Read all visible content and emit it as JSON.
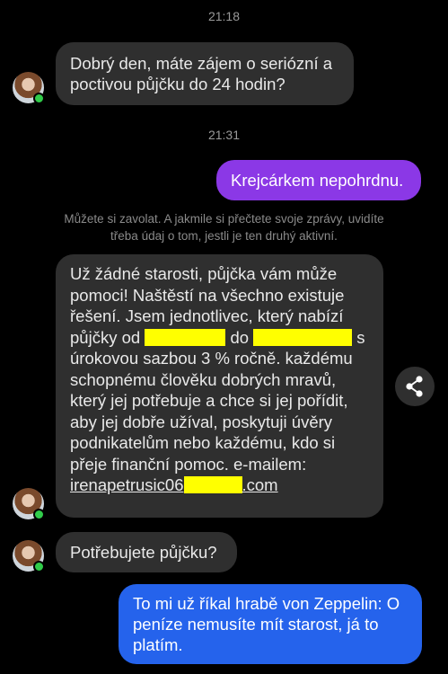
{
  "messages": {
    "ts1": "21:18",
    "msg1": "Dobrý den, máte zájem o seriózní a poctivou půjčku do 24 hodin?",
    "ts2": "21:31",
    "msg2": "Krejcárkem nepohrdnu.",
    "notice": "Můžete si zavolat. A jakmile si přečtete svoje zprávy, uvidíte třeba údaj o tom, jestli je ten druhý aktivní.",
    "msg3_part1": "Už žádné starosti, půjčka vám může pomoci!  Naštěstí na všechno existuje řešení.  Jsem jednotlivec, který nabízí půjčky od",
    "msg3_part2": "do",
    "msg3_part3": "s úrokovou sazbou 3 % ročně. každému schopnému člověku dobrých mravů, který jej potřebuje a chce si jej pořídit, aby jej dobře užíval, poskytuji úvěry podnikatelům nebo každému, kdo si přeje finanční pomoc. e-mailem:",
    "email_start": "irenapetrusic06",
    "email_end": ".com",
    "msg4": "Potřebujete půjčku?",
    "msg5": "To mi už říkal hrabě von Zeppelin: O peníze nemusíte mít starost, já to platím."
  },
  "colors": {
    "incoming": "#2f2f2f",
    "outgoing_purple": "#8b38e6",
    "outgoing_blue": "#2563ec",
    "online_dot": "#31cc4a",
    "redaction": "#ffff00"
  },
  "icons": {
    "share": "share-icon",
    "avatar": "avatar"
  }
}
